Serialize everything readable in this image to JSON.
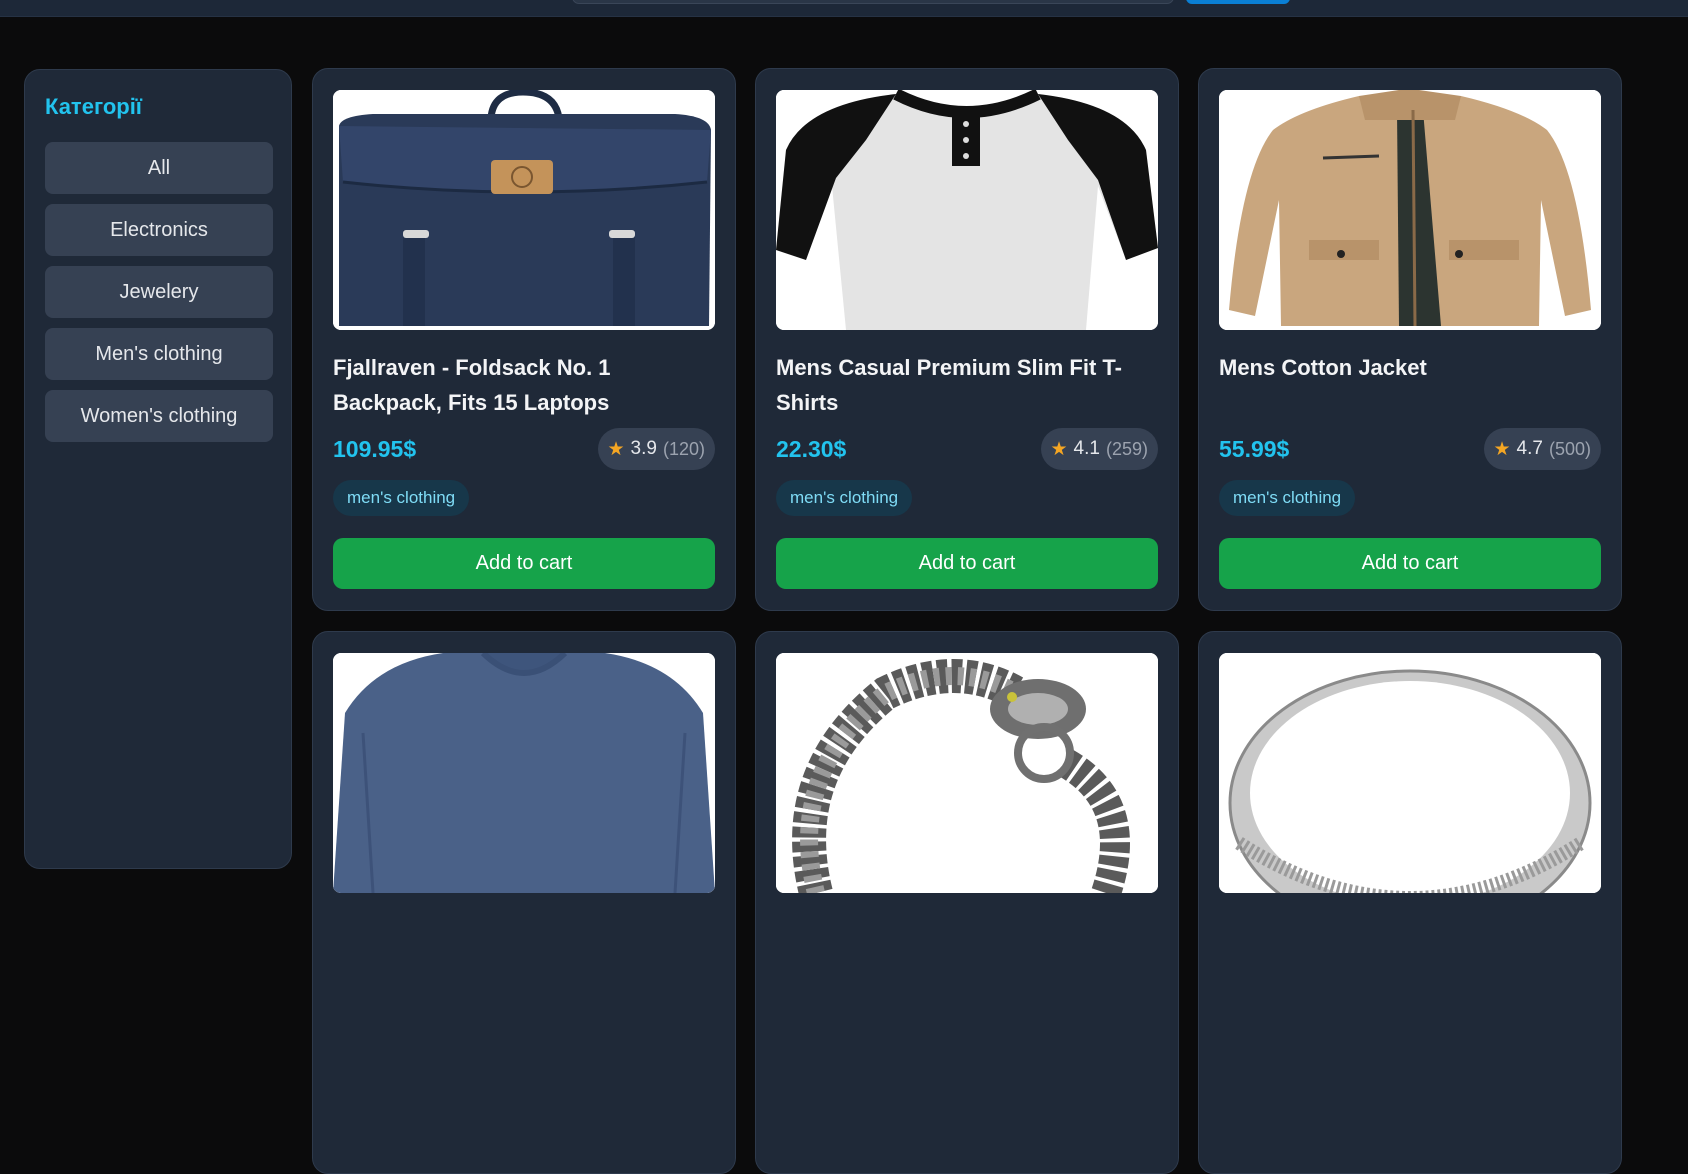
{
  "sidebar": {
    "title": "Категорії",
    "categories": [
      "All",
      "Electronics",
      "Jewelery",
      "Men's clothing",
      "Women's clothing"
    ]
  },
  "products": [
    {
      "title": "Fjallraven - Foldsack No. 1 Backpack, Fits 15 Laptops",
      "price": "109.95$",
      "rating": "3.9",
      "count": "(120)",
      "category": "men's clothing",
      "button": "Add to cart",
      "image": "backpack"
    },
    {
      "title": "Mens Casual Premium Slim Fit T-Shirts",
      "price": "22.30$",
      "rating": "4.1",
      "count": "(259)",
      "category": "men's clothing",
      "button": "Add to cart",
      "image": "raglan-tshirt"
    },
    {
      "title": "Mens Cotton Jacket",
      "price": "55.99$",
      "rating": "4.7",
      "count": "(500)",
      "category": "men's clothing",
      "button": "Add to cart",
      "image": "jacket"
    },
    {
      "image": "longsleeve-shirt"
    },
    {
      "image": "dragon-bracelet"
    },
    {
      "image": "silver-ring"
    }
  ],
  "colors": {
    "accent": "#22c3ee",
    "cart_button": "#16a34a",
    "star": "#f5a623",
    "card_bg": "#1f2938"
  }
}
